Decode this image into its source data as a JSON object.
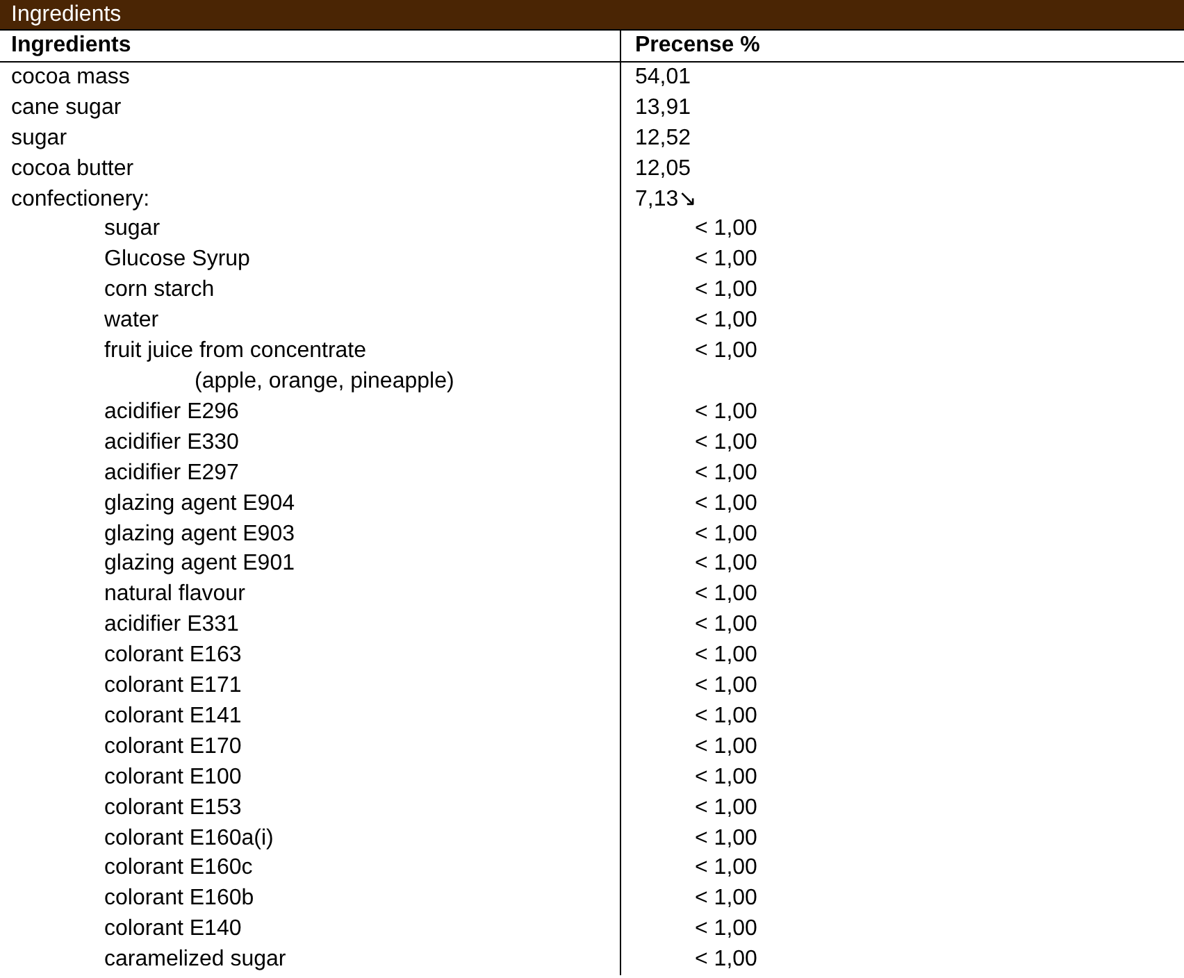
{
  "section_title": "Ingredients",
  "table": {
    "columns": [
      "Ingredients",
      "Precense %"
    ],
    "rows": [
      {
        "name": "cocoa mass",
        "value": "54,01"
      },
      {
        "name": "cane sugar",
        "value": "13,91"
      },
      {
        "name": "sugar",
        "value": "12,52"
      },
      {
        "name": "cocoa butter",
        "value": "12,05"
      },
      {
        "name": "confectionery:",
        "value": "7,13↘",
        "children": [
          {
            "name": "sugar",
            "value": "< 1,00"
          },
          {
            "name": "Glucose Syrup",
            "value": "< 1,00"
          },
          {
            "name": "corn starch",
            "value": "< 1,00"
          },
          {
            "name": "water",
            "value": "< 1,00"
          },
          {
            "name": "fruit juice from concentrate",
            "value": "< 1,00",
            "note": "(apple, orange, pineapple)"
          },
          {
            "name": "acidifier E296",
            "value": "< 1,00"
          },
          {
            "name": "acidifier E330",
            "value": "< 1,00"
          },
          {
            "name": "acidifier E297",
            "value": "< 1,00"
          },
          {
            "name": "glazing agent E904",
            "value": "< 1,00"
          },
          {
            "name": "glazing agent E903",
            "value": "< 1,00"
          },
          {
            "name": "glazing agent E901",
            "value": "< 1,00"
          },
          {
            "name": "natural flavour",
            "value": "< 1,00"
          },
          {
            "name": "acidifier E331",
            "value": "< 1,00"
          },
          {
            "name": "colorant E163",
            "value": "< 1,00"
          },
          {
            "name": "colorant E171",
            "value": "< 1,00"
          },
          {
            "name": "colorant E141",
            "value": "< 1,00"
          },
          {
            "name": "colorant E170",
            "value": "< 1,00"
          },
          {
            "name": "colorant E100",
            "value": "< 1,00"
          },
          {
            "name": "colorant E153",
            "value": "< 1,00"
          },
          {
            "name": "colorant E160a(i)",
            "value": "< 1,00"
          },
          {
            "name": "colorant E160c",
            "value": "< 1,00"
          },
          {
            "name": "colorant E160b",
            "value": "< 1,00"
          },
          {
            "name": "colorant E140",
            "value": "< 1,00"
          },
          {
            "name": "caramelized sugar",
            "value": "< 1,00"
          }
        ]
      }
    ]
  }
}
